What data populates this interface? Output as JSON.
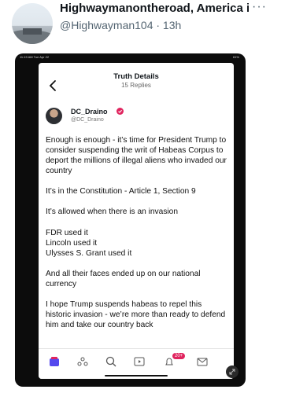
{
  "post": {
    "display_name": "Highwaymanontheroad, America is th...",
    "handle": "@Highwayman104 · 13h",
    "more": "···"
  },
  "device": {
    "status_time": "11:19 AM  Tue Apr 22",
    "status_battery": "61%"
  },
  "screen": {
    "title": "Truth Details",
    "subtitle": "15 Replies",
    "author": {
      "name": "DC_Draino",
      "handle": "@DC_Draino"
    },
    "body": [
      "Enough is enough - it’s time for President Trump to consider suspending the writ of Habeas Corpus to deport the millions of illegal aliens who invaded our country",
      "It’s in the Constitution - Article 1, Section 9",
      "It’s allowed when there is an invasion",
      "FDR used it\nLincoln used it\nUlysses S. Grant used it",
      "And all their faces ended up on our national currency",
      "I hope Trump suspends habeas to repel this historic invasion - we’re more than ready to defend him and take our country back"
    ],
    "notifications_badge": "20+"
  },
  "colors": {
    "accent": "#5448ee",
    "verified": "#e0245e"
  }
}
